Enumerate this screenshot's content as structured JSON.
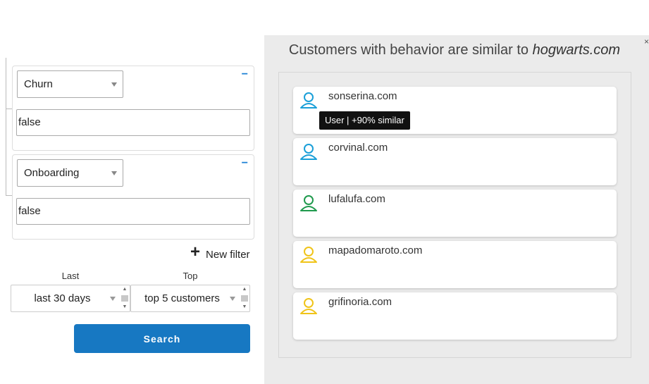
{
  "filters": [
    {
      "field": "Churn",
      "value": "false",
      "remove_label": "−"
    },
    {
      "field": "Onboarding",
      "value": "false",
      "remove_label": "−"
    }
  ],
  "new_filter": {
    "icon": "+",
    "label": "New filter"
  },
  "last": {
    "label": "Last",
    "value": "last 30 days"
  },
  "top": {
    "label": "Top",
    "value": "top 5 customers"
  },
  "search_button": "Search",
  "panel": {
    "title_prefix": "Customers with behavior are similar to ",
    "title_domain": "hogwarts.com",
    "close": "×"
  },
  "results": [
    {
      "domain": "sonserina.com",
      "color": "#1a9fd8"
    },
    {
      "domain": "corvinal.com",
      "color": "#1a9fd8"
    },
    {
      "domain": "lufalufa.com",
      "color": "#1f9a4d"
    },
    {
      "domain": "mapadomaroto.com",
      "color": "#f0c419"
    },
    {
      "domain": "grifinoria.com",
      "color": "#f0c419"
    }
  ],
  "tooltip": "User | +90% similar"
}
